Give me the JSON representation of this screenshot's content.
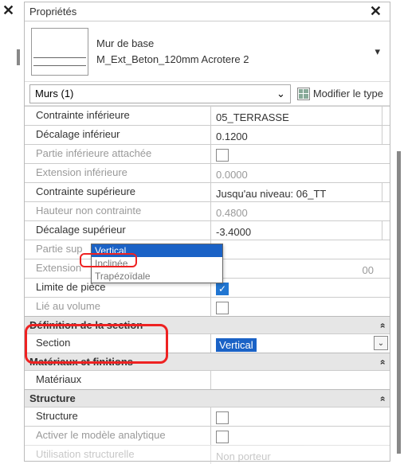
{
  "title": "Propriétés",
  "close_glyph": "✕",
  "type_header": {
    "family": "Mur de base",
    "type": "M_Ext_Beton_120mm Acrotere 2"
  },
  "category_selector": "Murs (1)",
  "edit_type_label": "Modifier le type",
  "dropdown": {
    "opt1": "Vertical",
    "opt2": "Inclinée",
    "opt3": "Trapézoïdale"
  },
  "props": {
    "contrainte_inf_label": "Contrainte inférieure",
    "contrainte_inf_value": "05_TERRASSE",
    "decalage_inf_label": "Décalage inférieur",
    "decalage_inf_value": "0.1200",
    "partie_inf_label": "Partie inférieure attachée",
    "ext_inf_label": "Extension inférieure",
    "ext_inf_value": "0.0000",
    "contrainte_sup_label": "Contrainte supérieure",
    "contrainte_sup_value": "Jusqu'au niveau: 06_TT",
    "hauteur_nc_label": "Hauteur non contrainte",
    "hauteur_nc_value": "0.4800",
    "decalage_sup_label": "Décalage supérieur",
    "decalage_sup_value": "-3.4000",
    "partie_sup_label": "Partie sup",
    "ext_sup_label": "Extension",
    "ext_sup_value": "00",
    "limite_label": "Limite de pièce",
    "lie_vol_label": "Lié au volume",
    "section_label": "Section",
    "section_value": "Vertical",
    "materiaux_label": "Matériaux",
    "structure_label": "Structure",
    "activer_label": "Activer le modèle analytique",
    "util_label": "Utilisation structurelle",
    "util_value": "Non porteur"
  },
  "groups": {
    "def_section": "Définition de la section",
    "mat_fin": "Matériaux et finitions",
    "structure": "Structure"
  },
  "checkmark": "✓",
  "chevron": "⌄",
  "dbl_chevron": "»"
}
